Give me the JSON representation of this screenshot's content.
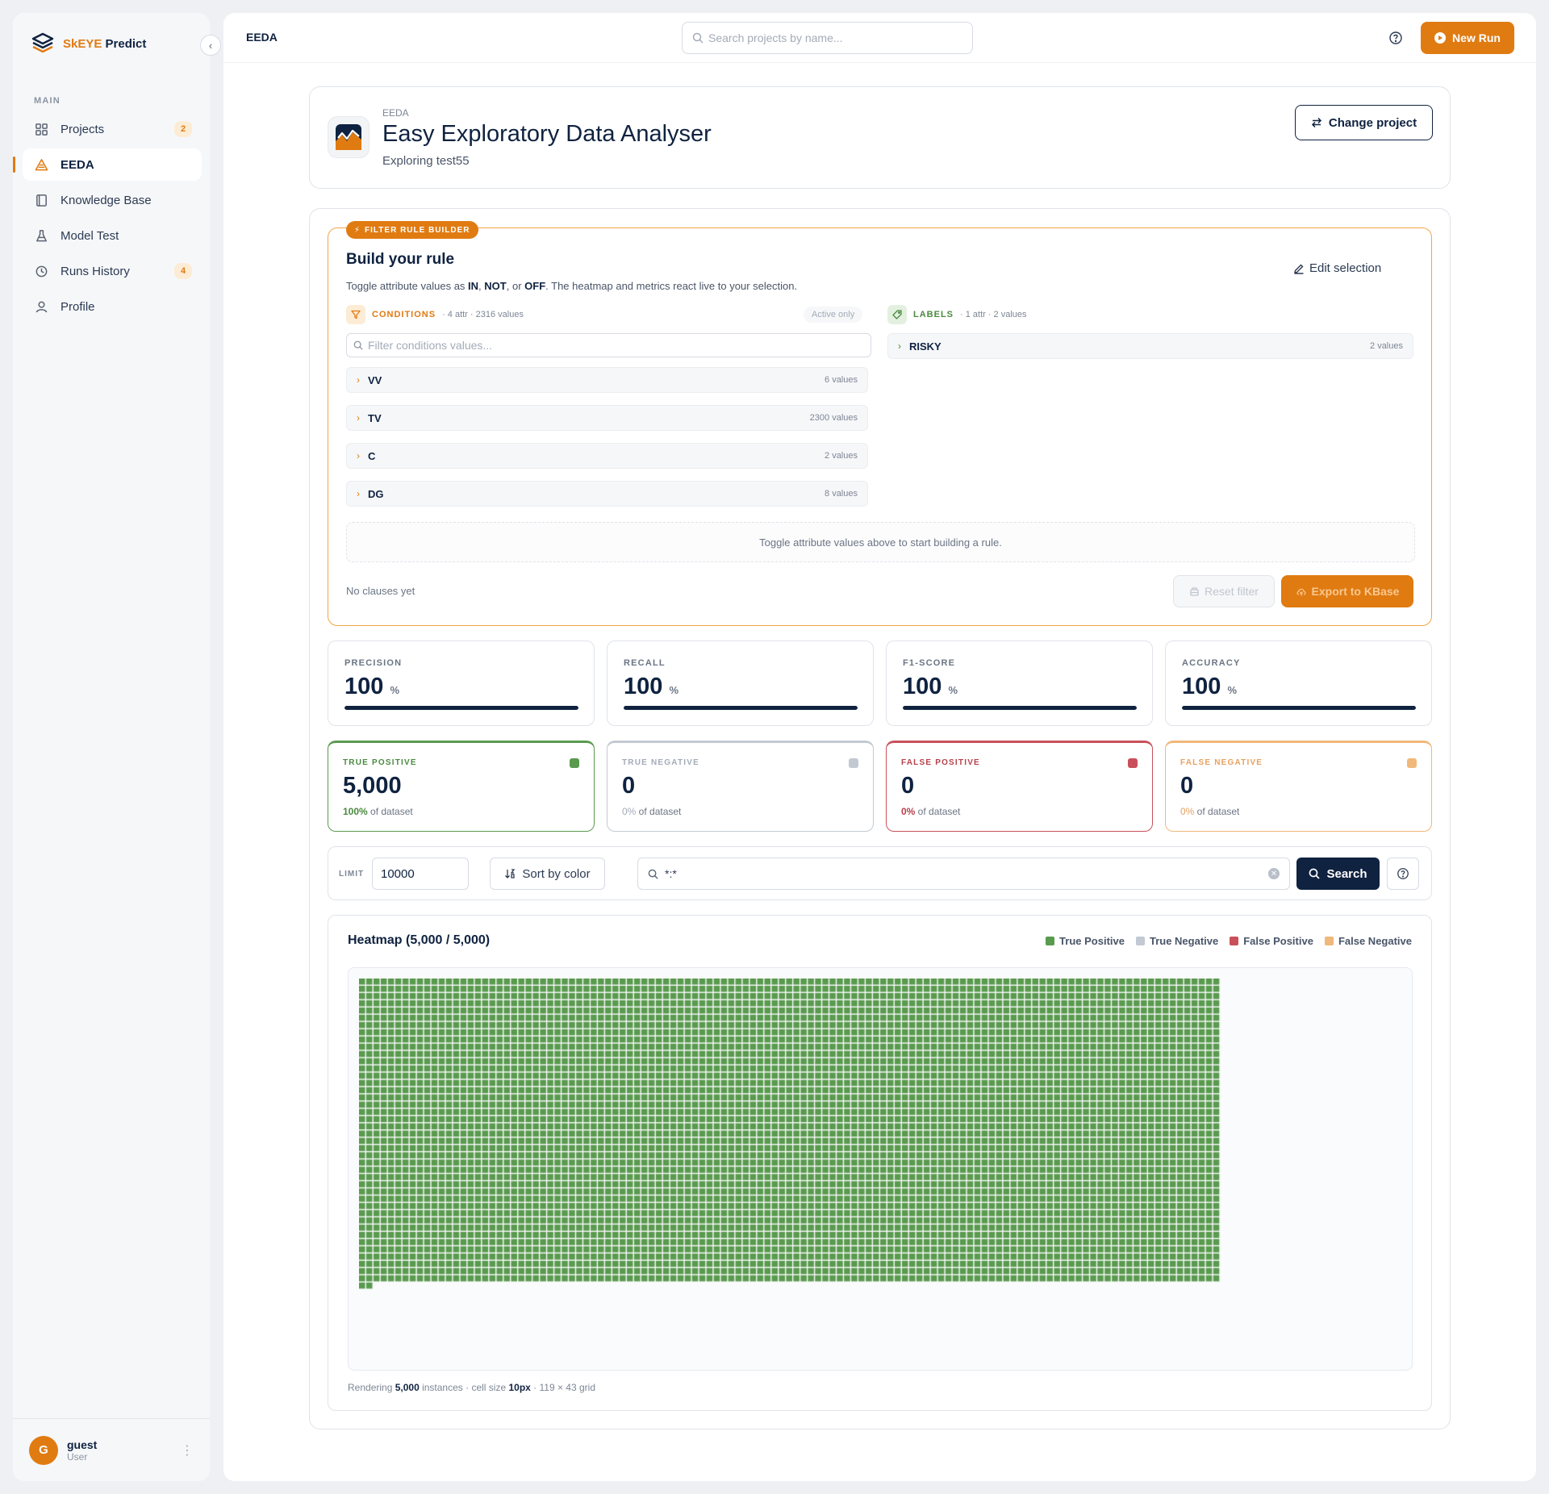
{
  "sidebar": {
    "brand_accent": "SkEYE",
    "brand_rest": " Predict",
    "section": "MAIN",
    "items": [
      {
        "label": "Projects",
        "badge": "2"
      },
      {
        "label": "EEDA",
        "badge": ""
      },
      {
        "label": "Knowledge Base",
        "badge": ""
      },
      {
        "label": "Model Test",
        "badge": ""
      },
      {
        "label": "Runs History",
        "badge": "4"
      },
      {
        "label": "Profile",
        "badge": ""
      }
    ],
    "user": {
      "initial": "G",
      "name": "guest",
      "role": "User"
    }
  },
  "topbar": {
    "breadcrumb": "EEDA",
    "search_placeholder": "Search projects by name...",
    "new_run": "New Run"
  },
  "project": {
    "small": "EEDA",
    "title": "Easy Exploratory Data Analyser",
    "subtitle": "Exploring test55",
    "change_button": "Change project"
  },
  "rule": {
    "tag": "FILTER RULE BUILDER",
    "title": "Build your rule",
    "desc_1": "Toggle attribute values as ",
    "desc_in": "IN",
    "desc_2": ", ",
    "desc_not": "NOT",
    "desc_3": ", or ",
    "desc_off": "OFF",
    "desc_4": ". The heatmap and metrics react live to your selection.",
    "edit_selection": "Edit selection",
    "conditions_title": "CONDITIONS",
    "conditions_meta": "· 4 attr · 2316 values",
    "active_only": "Active only",
    "filter_placeholder": "Filter conditions values...",
    "labels_title": "LABELS",
    "labels_meta": "· 1 attr · 2 values",
    "conditions": [
      {
        "name": "VV",
        "count": "6 values"
      },
      {
        "name": "TV",
        "count": "2300 values"
      },
      {
        "name": "C",
        "count": "2 values"
      },
      {
        "name": "DG",
        "count": "8 values"
      }
    ],
    "labels": [
      {
        "name": "RISKY",
        "count": "2 values"
      }
    ],
    "hint": "Toggle attribute values above to start building a rule.",
    "no_clauses": "No clauses yet",
    "reset": "Reset filter",
    "export": "Export to KBase"
  },
  "metrics": [
    {
      "label": "PRECISION",
      "value": "100",
      "unit": "%",
      "fraction": 1.0
    },
    {
      "label": "RECALL",
      "value": "100",
      "unit": "%",
      "fraction": 1.0
    },
    {
      "label": "F1-SCORE",
      "value": "100",
      "unit": "%",
      "fraction": 1.0
    },
    {
      "label": "ACCURACY",
      "value": "100",
      "unit": "%",
      "fraction": 1.0
    }
  ],
  "confusion": [
    {
      "label": "TRUE POSITIVE",
      "value": "5,000",
      "pct": "100%",
      "suffix": " of dataset",
      "color": "#5a9a4f",
      "label_color": "#4a8a3f"
    },
    {
      "label": "TRUE NEGATIVE",
      "value": "0",
      "pct": "0%",
      "suffix": " of dataset",
      "color": "#c3c9d2",
      "label_color": "#a3abb8"
    },
    {
      "label": "FALSE POSITIVE",
      "value": "0",
      "pct": "0%",
      "suffix": " of dataset",
      "color": "#c9505a",
      "label_color": "#b8404a"
    },
    {
      "label": "FALSE NEGATIVE",
      "value": "0",
      "pct": "0%",
      "suffix": " of dataset",
      "color": "#f0b87a",
      "label_color": "#e8a060"
    }
  ],
  "toolbar": {
    "limit_label": "LIMIT",
    "limit_value": "10000",
    "sort": "Sort by color",
    "query": "*:*",
    "search": "Search"
  },
  "heatmap": {
    "title": "Heatmap (5,000 / 5,000)",
    "legend": [
      {
        "label": "True Positive",
        "color": "#5a9a4f"
      },
      {
        "label": "True Negative",
        "color": "#c3c9d2"
      },
      {
        "label": "False Positive",
        "color": "#c9505a"
      },
      {
        "label": "False Negative",
        "color": "#f0b87a"
      }
    ],
    "instances": 5000,
    "columns": 119,
    "rows": 43,
    "cell_color": "#5a9a4f",
    "footer_1": "Rendering ",
    "footer_count": "5,000",
    "footer_2": " instances · cell size ",
    "footer_cell": "10px",
    "footer_3": " · 119 × 43 grid"
  },
  "colors": {
    "accent": "#e07b12",
    "navy": "#0f2240"
  }
}
